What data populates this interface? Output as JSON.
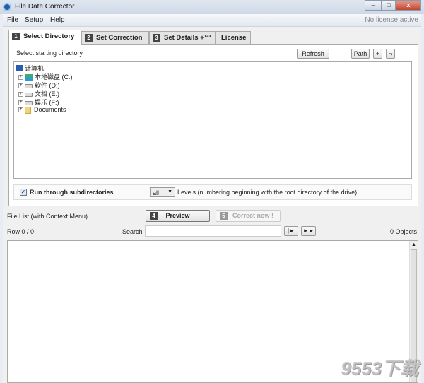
{
  "window": {
    "title": "File Date Corrector",
    "minimize": "–",
    "maximize": "□",
    "close": "x"
  },
  "menu": {
    "items": [
      "File",
      "Setup",
      "Help"
    ],
    "license_status": "No license active"
  },
  "tabs": [
    {
      "num": "1",
      "label": "Select Directory",
      "active": true
    },
    {
      "num": "2",
      "label": "Set Correction"
    },
    {
      "num": "3",
      "label": "Set Details +¹²³"
    },
    {
      "num": "",
      "label": "License"
    }
  ],
  "select_dir": {
    "label": "Select starting directory",
    "refresh": "Refresh",
    "path": "Path",
    "plus": "+",
    "minus": "¬"
  },
  "tree": {
    "root": "计算机",
    "nodes": [
      "本地磁盘 (C:)",
      "软件 (D:)",
      "文档 (E:)",
      "娱乐 (F:)",
      "Documents"
    ]
  },
  "options": {
    "run_subdirs": "Run through subdirectories",
    "run_subdirs_checked": true,
    "levels_value": "all",
    "levels_text": "Levels  (numbering beginning with the root directory of the drive)"
  },
  "file_list": {
    "label": "File List (with Context Menu)",
    "preview_num": "4",
    "preview": "Preview",
    "correct_num": "5",
    "correct": "Correct now !",
    "row": "Row 0 / 0",
    "search_label": "Search",
    "search_value": "",
    "next": "|►",
    "fast": "►►",
    "objects": "0 Objects"
  },
  "watermark": "9553下载"
}
